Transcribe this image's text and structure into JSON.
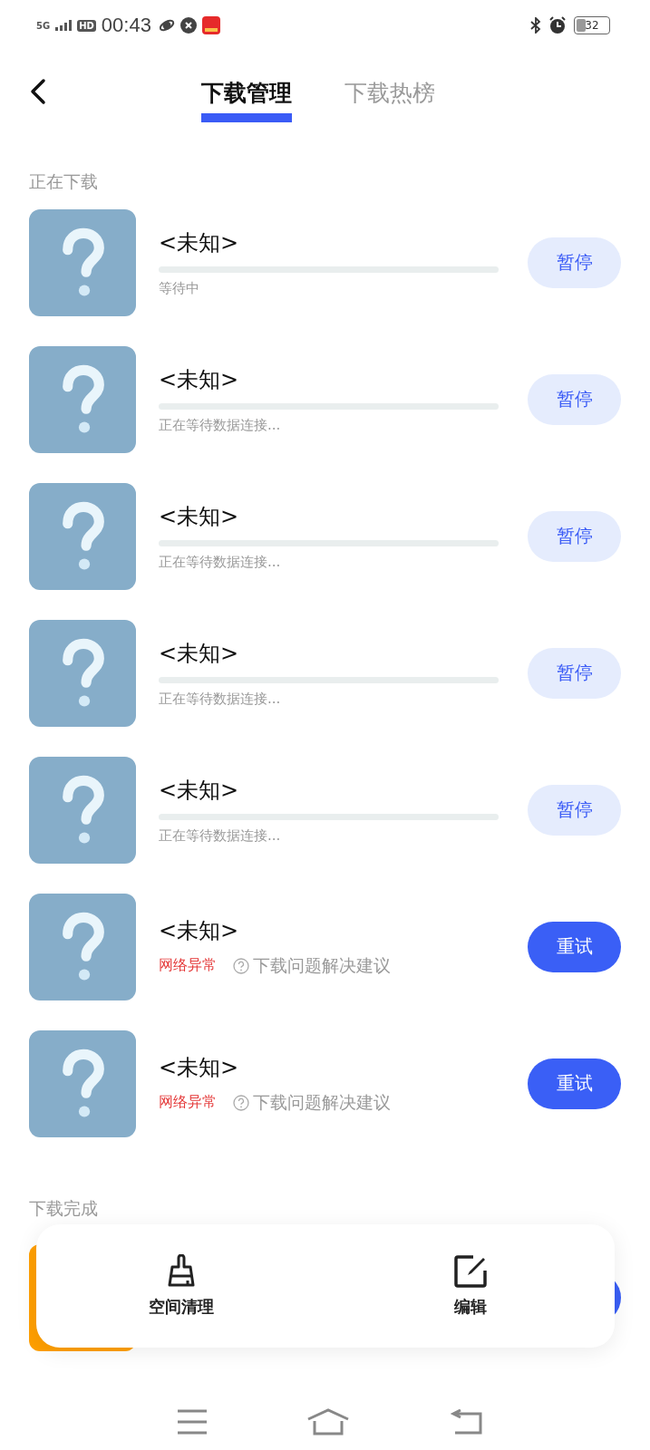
{
  "status_bar": {
    "network": "5G",
    "hd": "HD",
    "time": "00:43",
    "battery": "32"
  },
  "tabs": [
    {
      "label": "下载管理",
      "selected": true
    },
    {
      "label": "下载热榜",
      "selected": false
    }
  ],
  "downloading": {
    "title": "正在下载",
    "items": [
      {
        "kind": "active",
        "title": "<未知>",
        "status": "等待中",
        "button": "暂停"
      },
      {
        "kind": "active",
        "title": "<未知>",
        "status": "正在等待数据连接...",
        "button": "暂停"
      },
      {
        "kind": "active",
        "title": "<未知>",
        "status": "正在等待数据连接...",
        "button": "暂停"
      },
      {
        "kind": "active",
        "title": "<未知>",
        "status": "正在等待数据连接...",
        "button": "暂停"
      },
      {
        "kind": "active",
        "title": "<未知>",
        "status": "正在等待数据连接...",
        "button": "暂停"
      },
      {
        "kind": "error",
        "title": "<未知>",
        "status": "网络异常",
        "help": "下载问题解决建议",
        "button": "重试"
      },
      {
        "kind": "error",
        "title": "<未知>",
        "status": "网络异常",
        "help": "下载问题解决建议",
        "button": "重试"
      }
    ]
  },
  "completed": {
    "title": "下载完成",
    "items": [
      {
        "kind": "done"
      }
    ]
  },
  "toolbar": [
    {
      "kind": "clean",
      "label": "空间清理"
    },
    {
      "kind": "edit",
      "label": "编辑"
    }
  ]
}
